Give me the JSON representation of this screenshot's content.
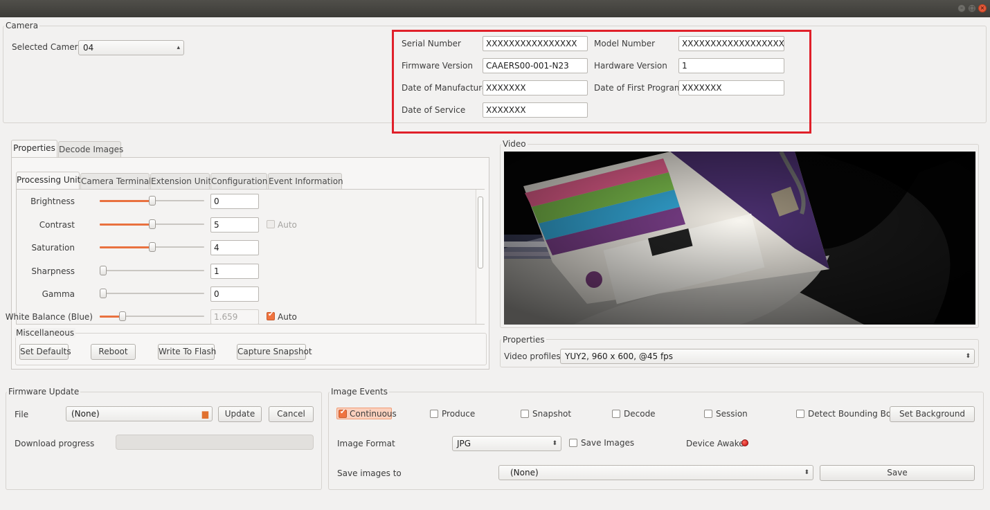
{
  "camera": {
    "group_title": "Camera",
    "selected_label": "Selected Camera",
    "selected_value": "04",
    "info": {
      "serial_label": "Serial Number",
      "serial_value": "XXXXXXXXXXXXXXXX",
      "model_label": "Model Number",
      "model_value": "XXXXXXXXXXXXXXXXXX",
      "firmware_label": "Firmware Version",
      "firmware_value": "CAAERS00-001-N23",
      "hardware_label": "Hardware Version",
      "hardware_value": "1",
      "manufacture_label": "Date of Manufacture",
      "manufacture_value": "XXXXXXX",
      "first_program_label": "Date of First Program",
      "first_program_value": "XXXXXXX",
      "service_label": "Date of Service",
      "service_value": "XXXXXXX"
    }
  },
  "main_tabs": [
    "Properties",
    "Decode Images"
  ],
  "sub_tabs": [
    "Processing Unit",
    "Camera Terminal",
    "Extension Unit",
    "Configuration",
    "Event Information"
  ],
  "controls": [
    {
      "label": "Brightness",
      "value": "0",
      "level": 0.5,
      "auto": null
    },
    {
      "label": "Contrast",
      "value": "5",
      "level": 0.5,
      "auto": "Auto"
    },
    {
      "label": "Saturation",
      "value": "4",
      "level": 0.5,
      "auto": null
    },
    {
      "label": "Sharpness",
      "value": "1",
      "level": 0.0,
      "auto": null
    },
    {
      "label": "Gamma",
      "value": "0",
      "level": 0.0,
      "auto": null
    },
    {
      "label": "White Balance (Blue)",
      "value": "1.659",
      "level": 0.22,
      "auto": "Auto"
    }
  ],
  "misc": {
    "title": "Miscellaneous",
    "set_defaults": "Set Defaults",
    "reboot": "Reboot",
    "write_flash": "Write To Flash",
    "capture": "Capture Snapshot"
  },
  "video": {
    "title": "Video",
    "properties_title": "Properties",
    "profiles_label": "Video profiles",
    "profile_value": "YUY2, 960 x 600, @45 fps"
  },
  "firmware": {
    "title": "Firmware Update",
    "file_label": "File",
    "file_value": "(None)",
    "update": "Update",
    "cancel": "Cancel",
    "progress_label": "Download progress",
    "progress": 0
  },
  "events": {
    "title": "Image Events",
    "checks": [
      "Continuous",
      "Produce",
      "Snapshot",
      "Decode",
      "Session",
      "Detect Bounding Box"
    ],
    "set_background": "Set Background",
    "format_label": "Image Format",
    "format_value": "JPG",
    "save_images": "Save Images",
    "awake_label": "Device Awake",
    "save_to_label": "Save images to",
    "save_to_value": "(None)",
    "save": "Save"
  },
  "colors": {
    "accent": "#f0733f",
    "highlight_box": "#e0202a"
  }
}
